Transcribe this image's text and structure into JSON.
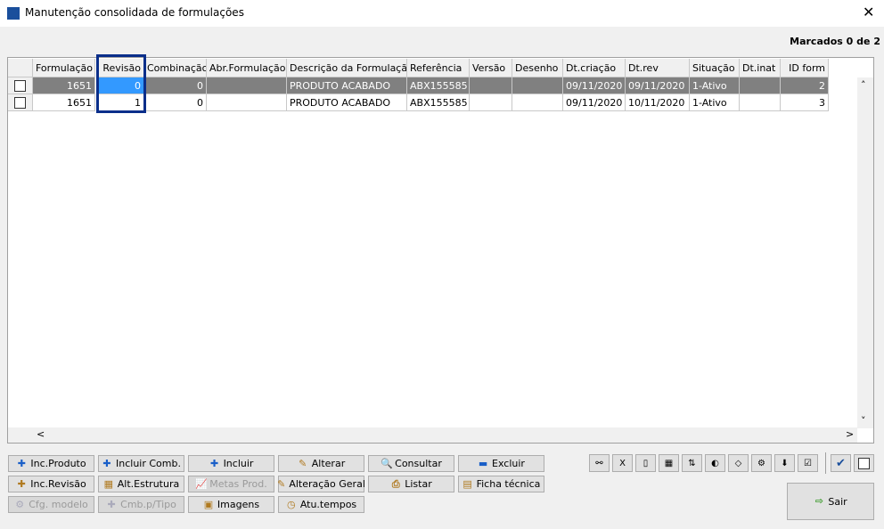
{
  "window": {
    "title": "Manutenção consolidada de formulações",
    "close": "✕"
  },
  "marked": "Marcados 0 de 2",
  "columns": [
    "",
    "Formulação",
    "Revisão",
    "Combinação",
    "Abr.Formulação",
    "Descrição da Formulação",
    "Referência",
    "Versão",
    "Desenho",
    "Dt.criação",
    "Dt.rev",
    "Situação",
    "Dt.inat",
    "ID form"
  ],
  "rows": [
    {
      "selected": true,
      "checked": false,
      "cells": [
        "1651",
        "0",
        "0",
        "",
        "PRODUTO ACABADO",
        "ABX155585",
        "",
        "",
        "09/11/2020",
        "09/11/2020",
        "1-Ativo",
        "",
        "2"
      ]
    },
    {
      "selected": false,
      "checked": false,
      "cells": [
        "1651",
        "1",
        "0",
        "",
        "PRODUTO ACABADO",
        "ABX155585",
        "",
        "",
        "09/11/2020",
        "10/11/2020",
        "1-Ativo",
        "",
        "3"
      ]
    }
  ],
  "highlight_color": "#0a2e8a",
  "active_cell_color": "#3399ff",
  "scroll": {
    "up": "˄",
    "down": "˅",
    "left": "<",
    "right": ">"
  },
  "buttons": [
    {
      "label": "Inc.Produto",
      "icon": "plus-icon",
      "glyph": "✚",
      "enabled": true
    },
    {
      "label": "Incluir Comb.",
      "icon": "plus-icon",
      "glyph": "✚",
      "enabled": true
    },
    {
      "label": "Incluir",
      "icon": "plus-icon",
      "glyph": "✚",
      "enabled": true
    },
    {
      "label": "Alterar",
      "icon": "edit-hand-icon",
      "glyph": "✎",
      "enabled": true
    },
    {
      "label": "Consultar",
      "icon": "search-doc-icon",
      "glyph": "🔍",
      "enabled": true
    },
    {
      "label": "Excluir",
      "icon": "minus-icon",
      "glyph": "▬",
      "enabled": true
    },
    {
      "label": "Inc.Revisão",
      "icon": "add-folder-icon",
      "glyph": "✚",
      "enabled": true
    },
    {
      "label": "Alt.Estrutura",
      "icon": "structure-icon",
      "glyph": "▦",
      "enabled": true
    },
    {
      "label": "Metas Prod.",
      "icon": "chart-icon",
      "glyph": "📈",
      "enabled": false
    },
    {
      "label": "Alteração Geral",
      "icon": "edit-hand-icon",
      "glyph": "✎",
      "enabled": true
    },
    {
      "label": "Listar",
      "icon": "printer-icon",
      "glyph": "⎙",
      "enabled": true
    },
    {
      "label": "Ficha técnica",
      "icon": "document-icon",
      "glyph": "▤",
      "enabled": true
    },
    {
      "label": "Cfg. modelo",
      "icon": "gear-icon",
      "glyph": "⚙",
      "enabled": false
    },
    {
      "label": "Cmb.p/Tipo",
      "icon": "plus-icon",
      "glyph": "✚",
      "enabled": false
    },
    {
      "label": "Imagens",
      "icon": "image-icon",
      "glyph": "▣",
      "enabled": true
    },
    {
      "label": "Atu.tempos",
      "icon": "clock-icon",
      "glyph": "◷",
      "enabled": true
    }
  ],
  "toolbar_icons": [
    {
      "icon": "binoculars-icon",
      "glyph": "⚯"
    },
    {
      "icon": "excel-icon",
      "glyph": "X"
    },
    {
      "icon": "document-icon",
      "glyph": "▯"
    },
    {
      "icon": "report-icon",
      "glyph": "▦"
    },
    {
      "icon": "sort-icon",
      "glyph": "⇅"
    },
    {
      "icon": "palette-icon",
      "glyph": "◐"
    },
    {
      "icon": "eraser-icon",
      "glyph": "◇"
    },
    {
      "icon": "gear-icon",
      "glyph": "⚙"
    },
    {
      "icon": "download-icon",
      "glyph": "⬇"
    },
    {
      "icon": "checklist-icon",
      "glyph": "☑"
    }
  ],
  "check_all": "✔",
  "exit": {
    "label": "Sair",
    "glyph": "⇨"
  }
}
